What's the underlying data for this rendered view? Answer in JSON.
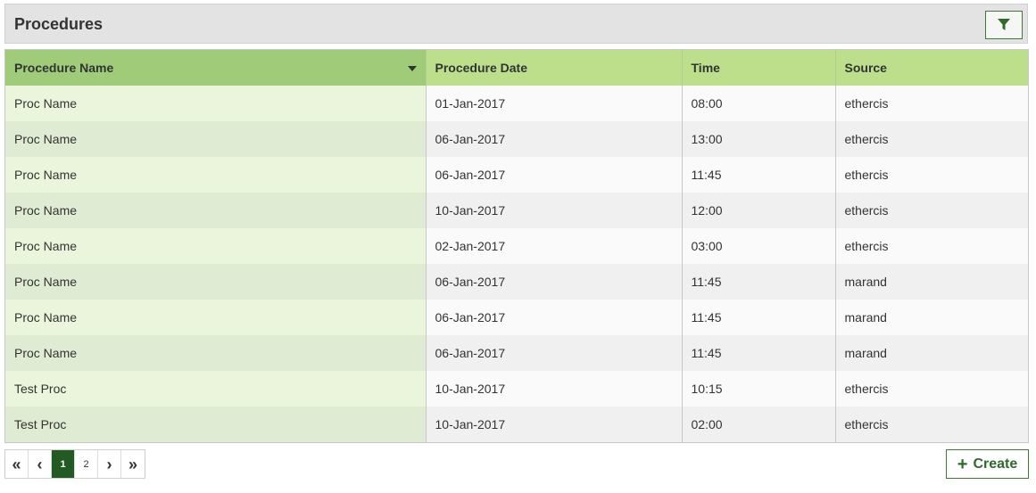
{
  "panel": {
    "title": "Procedures",
    "filter_icon": "filter-icon"
  },
  "table": {
    "columns": [
      {
        "label": "Procedure Name",
        "sorted": true
      },
      {
        "label": "Procedure Date"
      },
      {
        "label": "Time"
      },
      {
        "label": "Source"
      }
    ],
    "rows": [
      {
        "name": "Proc Name",
        "date": "01-Jan-2017",
        "time": "08:00",
        "source": "ethercis"
      },
      {
        "name": "Proc Name",
        "date": "06-Jan-2017",
        "time": "13:00",
        "source": "ethercis"
      },
      {
        "name": "Proc Name",
        "date": "06-Jan-2017",
        "time": "11:45",
        "source": "ethercis"
      },
      {
        "name": "Proc Name",
        "date": "10-Jan-2017",
        "time": "12:00",
        "source": "ethercis"
      },
      {
        "name": "Proc Name",
        "date": "02-Jan-2017",
        "time": "03:00",
        "source": "ethercis"
      },
      {
        "name": "Proc Name",
        "date": "06-Jan-2017",
        "time": "11:45",
        "source": "marand"
      },
      {
        "name": "Proc Name",
        "date": "06-Jan-2017",
        "time": "11:45",
        "source": "marand"
      },
      {
        "name": "Proc Name",
        "date": "06-Jan-2017",
        "time": "11:45",
        "source": "marand"
      },
      {
        "name": "Test Proc",
        "date": "10-Jan-2017",
        "time": "10:15",
        "source": "ethercis"
      },
      {
        "name": "Test Proc",
        "date": "10-Jan-2017",
        "time": "02:00",
        "source": "ethercis"
      }
    ]
  },
  "pagination": {
    "first": "«",
    "prev": "‹",
    "pages": [
      "1",
      "2"
    ],
    "active_page": "1",
    "next": "›",
    "last": "»"
  },
  "create_button": {
    "icon": "plus-icon",
    "label": "Create"
  },
  "colors": {
    "header_green": "#bddf8c",
    "sorted_header": "#a0cc7a",
    "active_page": "#215b23",
    "accent": "#3f7a33"
  }
}
